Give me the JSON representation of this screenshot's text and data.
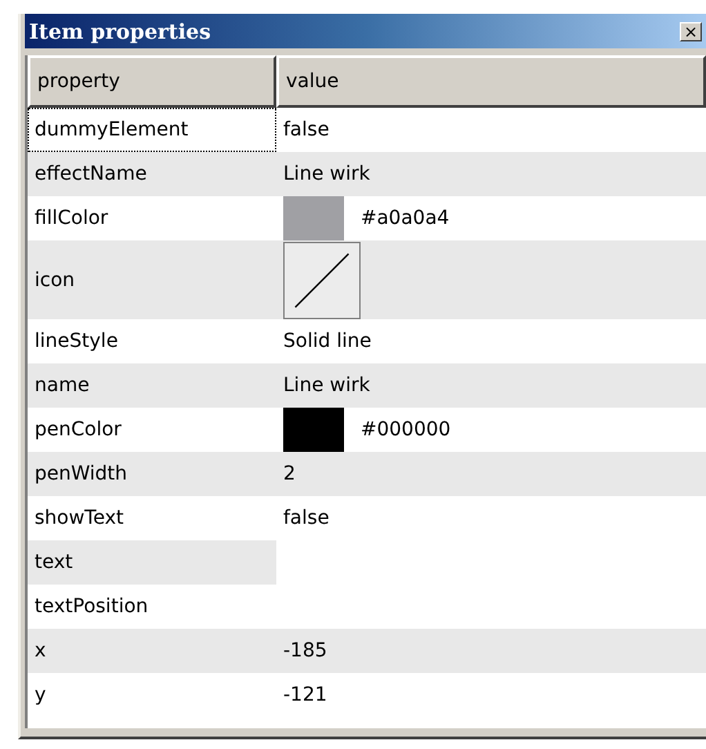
{
  "window": {
    "title": "Item properties",
    "close": "×"
  },
  "columns": [
    "property",
    "value"
  ],
  "rows": [
    {
      "property": "dummyElement",
      "kind": "text",
      "value": "false",
      "selected": true
    },
    {
      "property": "effectName",
      "kind": "text",
      "value": "Line wirk",
      "selected": false
    },
    {
      "property": "fillColor",
      "kind": "color",
      "value": "#a0a0a4",
      "color": "#a0a0a4",
      "selected": false
    },
    {
      "property": "icon",
      "kind": "icon",
      "selected": false
    },
    {
      "property": "lineStyle",
      "kind": "text",
      "value": "Solid line",
      "selected": false
    },
    {
      "property": "name",
      "kind": "text",
      "value": "Line wirk",
      "selected": false
    },
    {
      "property": "penColor",
      "kind": "color",
      "value": "#000000",
      "color": "#000000",
      "selected": false
    },
    {
      "property": "penWidth",
      "kind": "text",
      "value": "2",
      "selected": false
    },
    {
      "property": "showText",
      "kind": "text",
      "value": "false",
      "selected": false
    },
    {
      "property": "text",
      "kind": "editor",
      "selected": false
    },
    {
      "property": "textPosition",
      "kind": "empty",
      "selected": false
    },
    {
      "property": "x",
      "kind": "text",
      "value": "-185",
      "selected": false
    },
    {
      "property": "y",
      "kind": "text",
      "value": "-121",
      "selected": false
    }
  ]
}
